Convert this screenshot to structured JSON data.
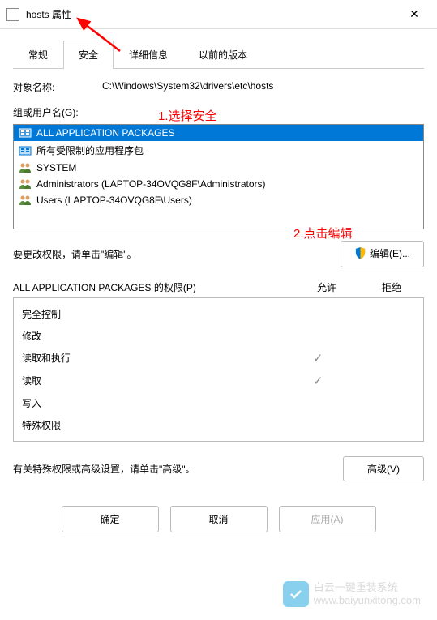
{
  "window": {
    "title": "hosts 属性"
  },
  "tabs": {
    "general": "常规",
    "security": "安全",
    "details": "详细信息",
    "previous": "以前的版本"
  },
  "object": {
    "label": "对象名称:",
    "value": "C:\\Windows\\System32\\drivers\\etc\\hosts"
  },
  "annotations": {
    "step1": "1.选择安全",
    "step2": "2.点击编辑"
  },
  "groups": {
    "label": "组或用户名(G):",
    "items": [
      {
        "text": "ALL APPLICATION PACKAGES",
        "icon": "pkg",
        "selected": true
      },
      {
        "text": "所有受限制的应用程序包",
        "icon": "pkg",
        "selected": false
      },
      {
        "text": "SYSTEM",
        "icon": "users",
        "selected": false
      },
      {
        "text": "Administrators (LAPTOP-34OVQG8F\\Administrators)",
        "icon": "users",
        "selected": false
      },
      {
        "text": "Users (LAPTOP-34OVQG8F\\Users)",
        "icon": "users",
        "selected": false
      }
    ]
  },
  "editRow": {
    "text": "要更改权限，请单击\"编辑\"。",
    "button": "编辑(E)..."
  },
  "permHeader": {
    "name": "ALL APPLICATION PACKAGES 的权限(P)",
    "allow": "允许",
    "deny": "拒绝"
  },
  "permissions": [
    {
      "label": "完全控制",
      "allow": false,
      "deny": false
    },
    {
      "label": "修改",
      "allow": false,
      "deny": false
    },
    {
      "label": "读取和执行",
      "allow": true,
      "deny": false
    },
    {
      "label": "读取",
      "allow": true,
      "deny": false
    },
    {
      "label": "写入",
      "allow": false,
      "deny": false
    },
    {
      "label": "特殊权限",
      "allow": false,
      "deny": false
    }
  ],
  "advanced": {
    "text": "有关特殊权限或高级设置，请单击\"高级\"。",
    "button": "高级(V)"
  },
  "buttons": {
    "ok": "确定",
    "cancel": "取消",
    "apply": "应用(A)"
  },
  "watermark": {
    "line1": "白云一键重装系统",
    "line2": "www.baiyunxitong.com"
  }
}
